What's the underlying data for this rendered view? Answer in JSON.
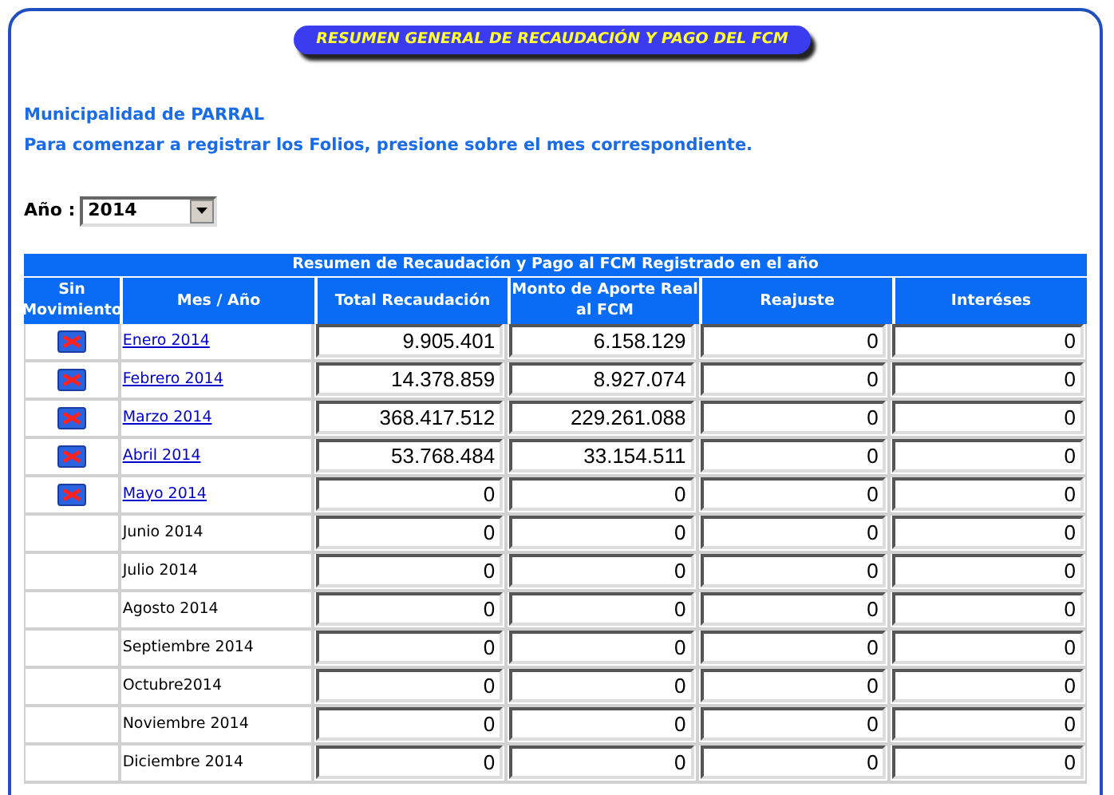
{
  "banner": "RESUMEN GENERAL DE RECAUDACIÓN Y PAGO DEL FCM",
  "intro": [
    "Municipalidad de PARRAL",
    "Para comenzar a registrar los Folios, presione sobre el mes correspondiente."
  ],
  "year": {
    "label": "Año :",
    "value": "2014"
  },
  "table": {
    "title": "Resumen de Recaudación y Pago al FCM Registrado en el año",
    "columns": [
      "Sin Movimiento",
      "Mes / Año",
      "Total Recaudación",
      "Monto de Aporte Real al FCM",
      "Reajuste",
      "Interéses"
    ],
    "rows": [
      {
        "month": "Enero 2014",
        "linked": true,
        "values": [
          "9.905.401",
          "6.158.129",
          "0",
          "0"
        ]
      },
      {
        "month": "Febrero 2014",
        "linked": true,
        "values": [
          "14.378.859",
          "8.927.074",
          "0",
          "0"
        ]
      },
      {
        "month": "Marzo 2014",
        "linked": true,
        "values": [
          "368.417.512",
          "229.261.088",
          "0",
          "0"
        ]
      },
      {
        "month": "Abril 2014",
        "linked": true,
        "values": [
          "53.768.484",
          "33.154.511",
          "0",
          "0"
        ]
      },
      {
        "month": "Mayo 2014",
        "linked": true,
        "values": [
          "0",
          "0",
          "0",
          "0"
        ]
      },
      {
        "month": "Junio 2014",
        "linked": false,
        "values": [
          "0",
          "0",
          "0",
          "0"
        ]
      },
      {
        "month": "Julio 2014",
        "linked": false,
        "values": [
          "0",
          "0",
          "0",
          "0"
        ]
      },
      {
        "month": "Agosto 2014",
        "linked": false,
        "values": [
          "0",
          "0",
          "0",
          "0"
        ]
      },
      {
        "month": "Septiembre 2014",
        "linked": false,
        "values": [
          "0",
          "0",
          "0",
          "0"
        ]
      },
      {
        "month": "Octubre2014",
        "linked": false,
        "values": [
          "0",
          "0",
          "0",
          "0"
        ]
      },
      {
        "month": "Noviembre 2014",
        "linked": false,
        "values": [
          "0",
          "0",
          "0",
          "0"
        ]
      },
      {
        "month": "Diciembre 2014",
        "linked": false,
        "values": [
          "0",
          "0",
          "0",
          "0"
        ]
      }
    ]
  }
}
